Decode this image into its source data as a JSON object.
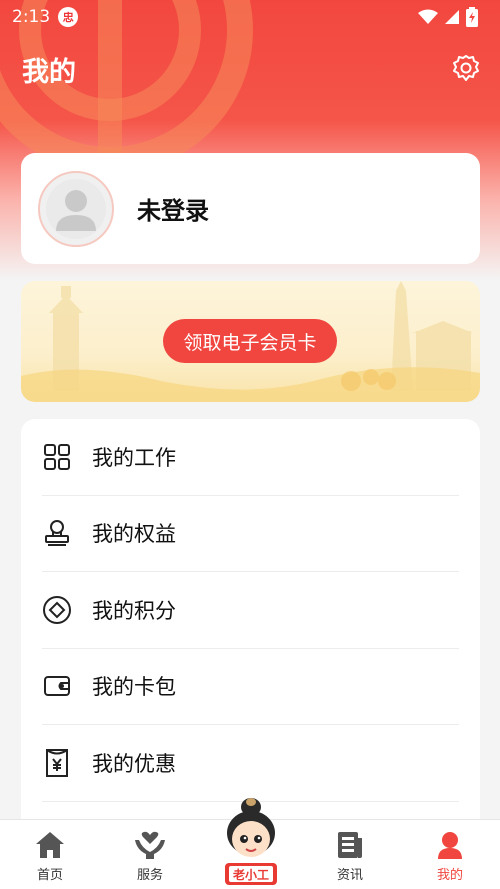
{
  "status_bar": {
    "time": "2:13",
    "badge": "忠"
  },
  "header": {
    "title": "我的",
    "settings_icon": "gear-icon"
  },
  "profile": {
    "login_text": "未登录",
    "avatar_icon": "default-avatar-icon"
  },
  "banner": {
    "button_label": "领取电子会员卡"
  },
  "menu": {
    "items": [
      {
        "label": "我的工作",
        "icon": "grid-icon"
      },
      {
        "label": "我的权益",
        "icon": "stamp-icon"
      },
      {
        "label": "我的积分",
        "icon": "diamond-coin-icon"
      },
      {
        "label": "我的卡包",
        "icon": "wallet-icon"
      },
      {
        "label": "我的优惠",
        "icon": "yen-coupon-icon"
      }
    ]
  },
  "tabbar": {
    "items": [
      {
        "label": "首页",
        "icon": "home-icon"
      },
      {
        "label": "服务",
        "icon": "heart-hands-icon"
      },
      {
        "label": "",
        "icon": "mascot-icon"
      },
      {
        "label": "资讯",
        "icon": "news-icon"
      },
      {
        "label": "我的",
        "icon": "user-icon"
      }
    ],
    "active_color": "#f0463f",
    "mascot_text": "老小工"
  },
  "colors": {
    "primary": "#f0463f",
    "background": "#f4f4f4"
  }
}
